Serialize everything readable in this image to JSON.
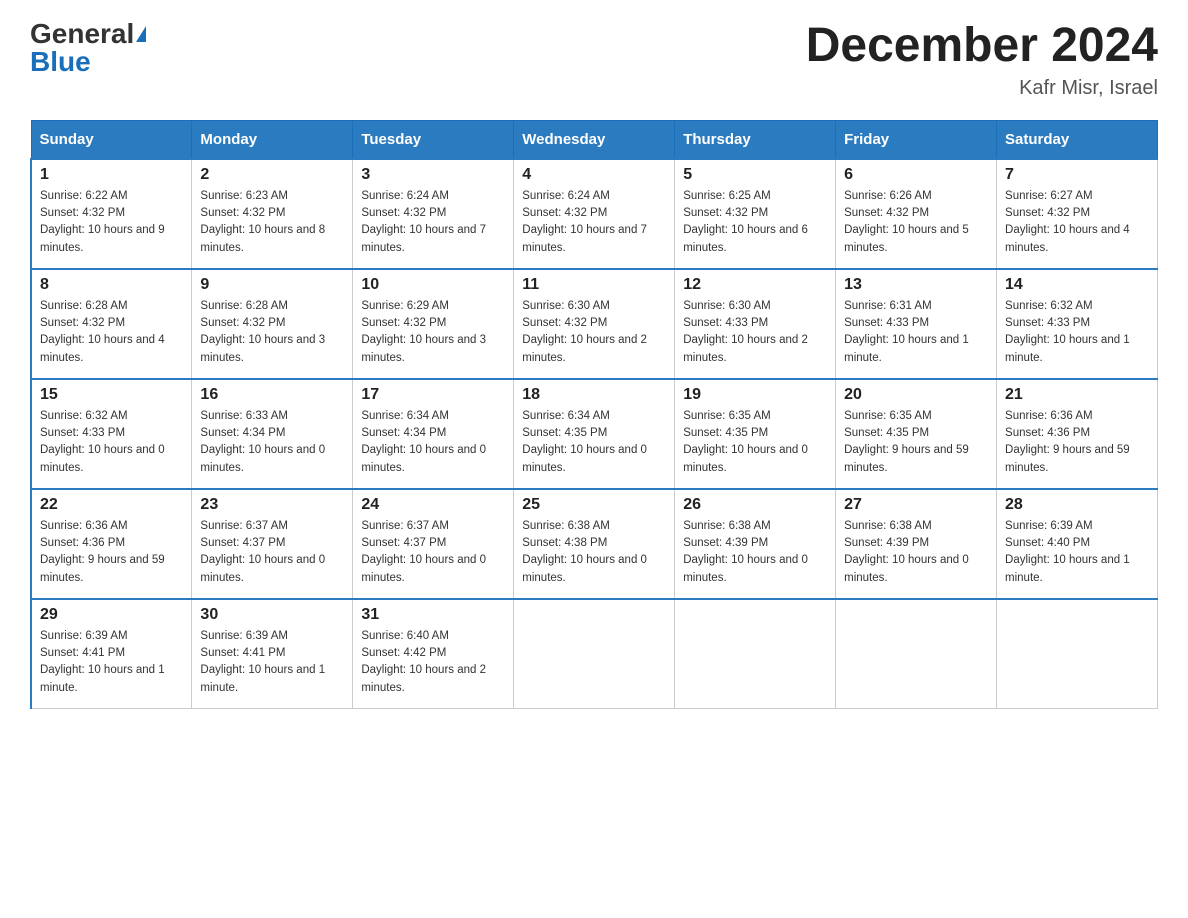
{
  "header": {
    "logo_general": "General",
    "logo_blue": "Blue",
    "month_title": "December 2024",
    "location": "Kafr Misr, Israel"
  },
  "days_of_week": [
    "Sunday",
    "Monday",
    "Tuesday",
    "Wednesday",
    "Thursday",
    "Friday",
    "Saturday"
  ],
  "weeks": [
    [
      {
        "day": "1",
        "sunrise": "6:22 AM",
        "sunset": "4:32 PM",
        "daylight": "10 hours and 9 minutes."
      },
      {
        "day": "2",
        "sunrise": "6:23 AM",
        "sunset": "4:32 PM",
        "daylight": "10 hours and 8 minutes."
      },
      {
        "day": "3",
        "sunrise": "6:24 AM",
        "sunset": "4:32 PM",
        "daylight": "10 hours and 7 minutes."
      },
      {
        "day": "4",
        "sunrise": "6:24 AM",
        "sunset": "4:32 PM",
        "daylight": "10 hours and 7 minutes."
      },
      {
        "day": "5",
        "sunrise": "6:25 AM",
        "sunset": "4:32 PM",
        "daylight": "10 hours and 6 minutes."
      },
      {
        "day": "6",
        "sunrise": "6:26 AM",
        "sunset": "4:32 PM",
        "daylight": "10 hours and 5 minutes."
      },
      {
        "day": "7",
        "sunrise": "6:27 AM",
        "sunset": "4:32 PM",
        "daylight": "10 hours and 4 minutes."
      }
    ],
    [
      {
        "day": "8",
        "sunrise": "6:28 AM",
        "sunset": "4:32 PM",
        "daylight": "10 hours and 4 minutes."
      },
      {
        "day": "9",
        "sunrise": "6:28 AM",
        "sunset": "4:32 PM",
        "daylight": "10 hours and 3 minutes."
      },
      {
        "day": "10",
        "sunrise": "6:29 AM",
        "sunset": "4:32 PM",
        "daylight": "10 hours and 3 minutes."
      },
      {
        "day": "11",
        "sunrise": "6:30 AM",
        "sunset": "4:32 PM",
        "daylight": "10 hours and 2 minutes."
      },
      {
        "day": "12",
        "sunrise": "6:30 AM",
        "sunset": "4:33 PM",
        "daylight": "10 hours and 2 minutes."
      },
      {
        "day": "13",
        "sunrise": "6:31 AM",
        "sunset": "4:33 PM",
        "daylight": "10 hours and 1 minute."
      },
      {
        "day": "14",
        "sunrise": "6:32 AM",
        "sunset": "4:33 PM",
        "daylight": "10 hours and 1 minute."
      }
    ],
    [
      {
        "day": "15",
        "sunrise": "6:32 AM",
        "sunset": "4:33 PM",
        "daylight": "10 hours and 0 minutes."
      },
      {
        "day": "16",
        "sunrise": "6:33 AM",
        "sunset": "4:34 PM",
        "daylight": "10 hours and 0 minutes."
      },
      {
        "day": "17",
        "sunrise": "6:34 AM",
        "sunset": "4:34 PM",
        "daylight": "10 hours and 0 minutes."
      },
      {
        "day": "18",
        "sunrise": "6:34 AM",
        "sunset": "4:35 PM",
        "daylight": "10 hours and 0 minutes."
      },
      {
        "day": "19",
        "sunrise": "6:35 AM",
        "sunset": "4:35 PM",
        "daylight": "10 hours and 0 minutes."
      },
      {
        "day": "20",
        "sunrise": "6:35 AM",
        "sunset": "4:35 PM",
        "daylight": "9 hours and 59 minutes."
      },
      {
        "day": "21",
        "sunrise": "6:36 AM",
        "sunset": "4:36 PM",
        "daylight": "9 hours and 59 minutes."
      }
    ],
    [
      {
        "day": "22",
        "sunrise": "6:36 AM",
        "sunset": "4:36 PM",
        "daylight": "9 hours and 59 minutes."
      },
      {
        "day": "23",
        "sunrise": "6:37 AM",
        "sunset": "4:37 PM",
        "daylight": "10 hours and 0 minutes."
      },
      {
        "day": "24",
        "sunrise": "6:37 AM",
        "sunset": "4:37 PM",
        "daylight": "10 hours and 0 minutes."
      },
      {
        "day": "25",
        "sunrise": "6:38 AM",
        "sunset": "4:38 PM",
        "daylight": "10 hours and 0 minutes."
      },
      {
        "day": "26",
        "sunrise": "6:38 AM",
        "sunset": "4:39 PM",
        "daylight": "10 hours and 0 minutes."
      },
      {
        "day": "27",
        "sunrise": "6:38 AM",
        "sunset": "4:39 PM",
        "daylight": "10 hours and 0 minutes."
      },
      {
        "day": "28",
        "sunrise": "6:39 AM",
        "sunset": "4:40 PM",
        "daylight": "10 hours and 1 minute."
      }
    ],
    [
      {
        "day": "29",
        "sunrise": "6:39 AM",
        "sunset": "4:41 PM",
        "daylight": "10 hours and 1 minute."
      },
      {
        "day": "30",
        "sunrise": "6:39 AM",
        "sunset": "4:41 PM",
        "daylight": "10 hours and 1 minute."
      },
      {
        "day": "31",
        "sunrise": "6:40 AM",
        "sunset": "4:42 PM",
        "daylight": "10 hours and 2 minutes."
      },
      null,
      null,
      null,
      null
    ]
  ],
  "labels": {
    "sunrise": "Sunrise:",
    "sunset": "Sunset:",
    "daylight": "Daylight:"
  }
}
